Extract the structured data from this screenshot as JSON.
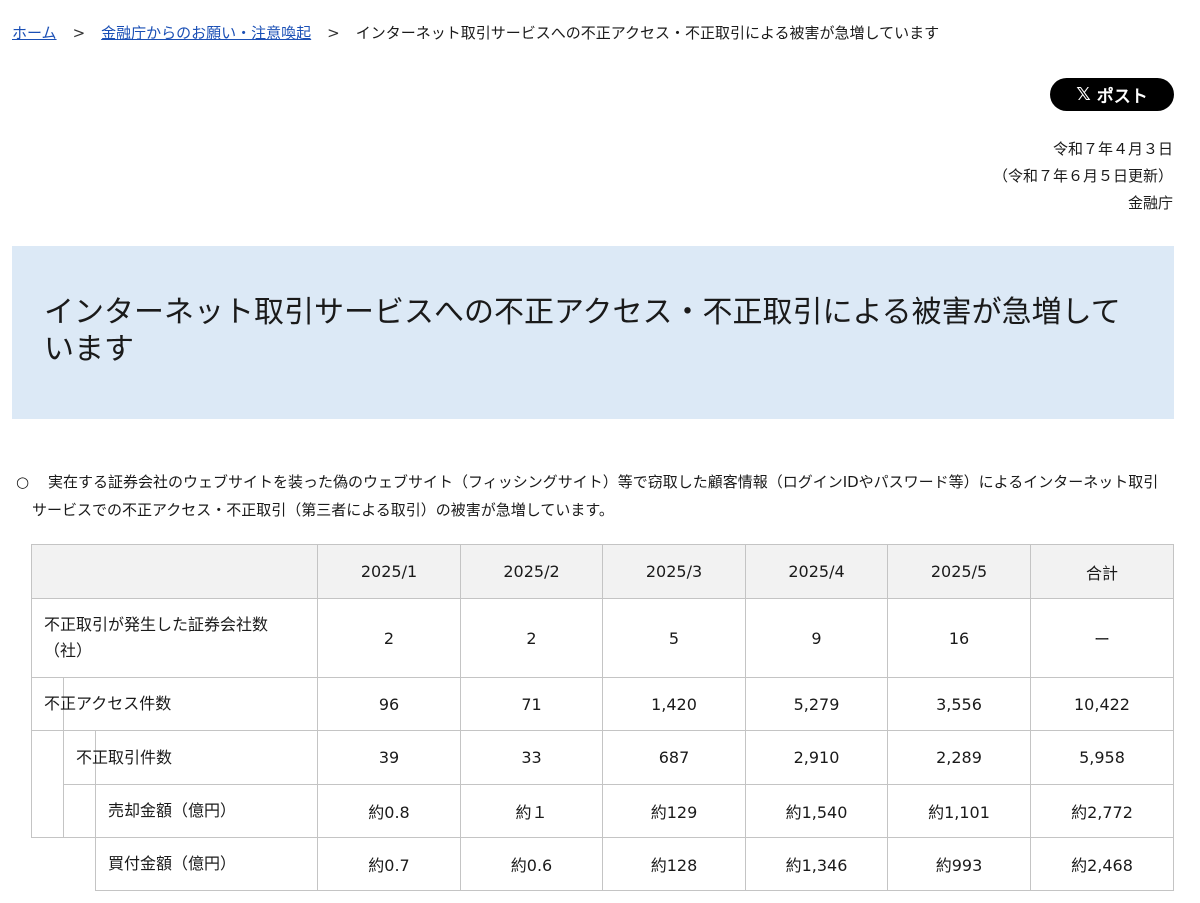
{
  "breadcrumb": {
    "home": "ホーム",
    "separator": ">",
    "parent": "金融庁からのお願い・注意喚起",
    "current": "インターネット取引サービスへの不正アクセス・不正取引による被害が急増しています"
  },
  "share": {
    "icon": "x-logo-icon",
    "label": "ポスト"
  },
  "meta": {
    "date": "令和７年４月３日",
    "updated": "（令和７年６月５日更新）",
    "agency": "金融庁"
  },
  "title": "インターネット取引サービスへの不正アクセス・不正取引による被害が急増しています",
  "lead": {
    "bullet": "○",
    "text": "実在する証券会社のウェブサイトを装った偽のウェブサイト（フィッシングサイト）等で窃取した顧客情報（ログインIDやパスワード等）によるインターネット取引サービスでの不正アクセス・不正取引（第三者による取引）の被害が急増しています。"
  },
  "table": {
    "headers": [
      "2025/1",
      "2025/2",
      "2025/3",
      "2025/4",
      "2025/5",
      "合計"
    ],
    "rows": [
      {
        "label": "不正取引が発生した証券会社数（社）",
        "values": [
          "2",
          "2",
          "5",
          "9",
          "16",
          "ー"
        ]
      },
      {
        "label": "不正アクセス件数",
        "values": [
          "96",
          "71",
          "1,420",
          "5,279",
          "3,556",
          "10,422"
        ]
      },
      {
        "label": "不正取引件数",
        "values": [
          "39",
          "33",
          "687",
          "2,910",
          "2,289",
          "5,958"
        ]
      },
      {
        "label": "売却金額（億円）",
        "values": [
          "約0.8",
          "約１",
          "約129",
          "約1,540",
          "約1,101",
          "約2,772"
        ]
      },
      {
        "label": "買付金額（億円）",
        "values": [
          "約0.7",
          "約0.6",
          "約128",
          "約1,346",
          "約993",
          "約2,468"
        ]
      }
    ]
  }
}
